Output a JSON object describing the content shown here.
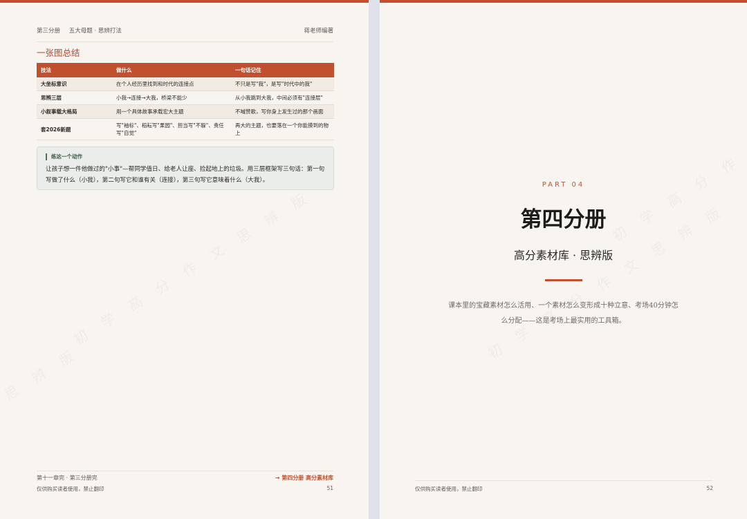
{
  "colors": {
    "accent": "#c0502e",
    "paper": "#f8f5f0",
    "background": "#dfe2ea",
    "callout_bg": "#eaede9"
  },
  "left_page": {
    "header": {
      "volume": "第三分册",
      "topic": "五大母题 · 思辨打法",
      "author": "蒋老师编著"
    },
    "section_title": "一张图总结",
    "table": {
      "headers": [
        "技法",
        "做什么",
        "一句话记住"
      ],
      "rows": [
        [
          "大坐标意识",
          "在个人经历里找到和时代的连接点",
          "不只是写\"我\"，是写\"时代中的我\""
        ],
        [
          "思辨三层",
          "小我→连接→大我，桥梁不能少",
          "从小我跳到大我，中间必须有\"连接层\""
        ],
        [
          "小叙事载大格局",
          "用一个具体故事承载宏大主题",
          "不喊赞歌，写你身上发生过的那个画面"
        ],
        [
          "套2026新题",
          "写\"袖标\"、稻耘写\"果园\"、担当写\"不躲\"、责任写\"自觉\"",
          "再大的主题，也要落在一个你能摸到的物上"
        ]
      ]
    },
    "callout": {
      "title": "练这一个动作",
      "body": "让孩子想一件他做过的\"小事\"—帮同学值日、给老人让座、捡起地上的垃圾。用三层框架写三句话：第一句写做了什么（小我），第二句写它和谁有关（连接），第三句写它意味着什么（大我）。"
    },
    "footer": {
      "end_note": "第十一章完 · 第三分册完",
      "next_link": "→ 第四分册 高分素材库",
      "copyright": "仅供购买读者使用，禁止翻印",
      "page_number": "51"
    }
  },
  "right_page": {
    "part_label": "PART 04",
    "title": "第四分册",
    "subtitle": "高分素材库 · 思辨版",
    "description": "课本里的宝藏素材怎么活用、一个素材怎么变形成十种立意、考场40分钟怎么分配——这是考场上最实用的工具箱。",
    "footer": {
      "copyright": "仅供购买读者使用，禁止翻印",
      "page_number": "52"
    }
  }
}
